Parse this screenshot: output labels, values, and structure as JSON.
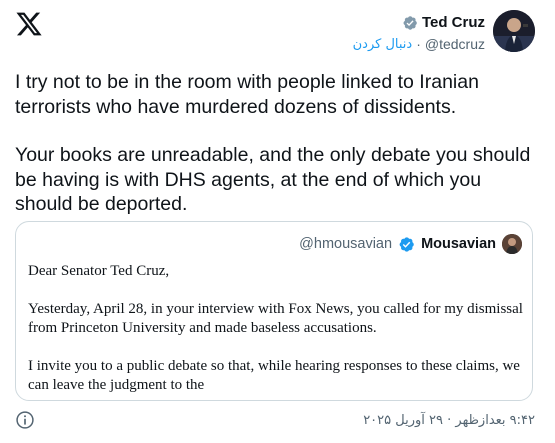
{
  "author": {
    "name": "Ted Cruz",
    "handle": "@tedcruz",
    "follow_label": "دنبال کردن",
    "separator": "·"
  },
  "tweet": {
    "paragraph1": "I try not to be in the room with people linked to Iranian terrorists who have murdered dozens of dissidents.",
    "paragraph2": "Your books are unreadable, and the only debate you should be having is with DHS agents, at the end of which you should be deported."
  },
  "quote": {
    "handle": "@hmousavian",
    "name": "Mousavian",
    "greeting": "Dear Senator Ted Cruz,",
    "paragraph1": "Yesterday, April 28, in your interview with Fox News, you called for my dismissal from Princeton University and made baseless accusations.",
    "paragraph2": "I invite you to a public debate so that, while hearing responses to these claims, we can leave the judgment to the"
  },
  "footer": {
    "timestamp": "۹:۴۲ بعدازظهر · ۲۹ آوریل ۲۰۲۵"
  },
  "icons": {
    "logo": "x-logo-icon",
    "author_badge": "grey-verified-badge-icon",
    "quote_badge": "blue-verified-badge-icon",
    "info": "info-icon"
  },
  "colors": {
    "link": "#1d9bf0",
    "muted": "#536471",
    "border": "#cfd9de",
    "badge_grey": "#829aab",
    "badge_blue": "#1d9bf0"
  }
}
